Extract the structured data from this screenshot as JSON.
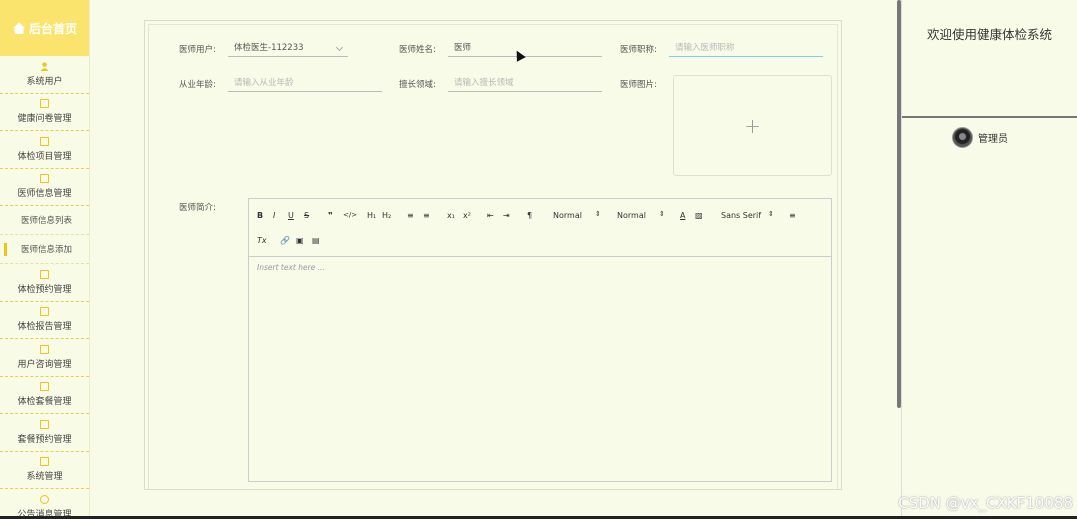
{
  "sidebar": {
    "title": "后台首页",
    "items": [
      {
        "label": "系统用户",
        "icon": "person-icon"
      },
      {
        "label": "健康问卷管理",
        "icon": "edit-icon"
      },
      {
        "label": "体检项目管理",
        "icon": "edit-icon"
      },
      {
        "label": "医师信息管理",
        "icon": "edit-icon"
      }
    ],
    "subitems": [
      {
        "label": "医师信息列表"
      },
      {
        "label": "医师信息添加"
      }
    ],
    "items2": [
      {
        "label": "体检预约管理",
        "icon": "edit-icon"
      },
      {
        "label": "体检报告管理",
        "icon": "edit-icon"
      },
      {
        "label": "用户咨询管理",
        "icon": "edit-icon"
      },
      {
        "label": "体检套餐管理",
        "icon": "edit-icon"
      },
      {
        "label": "套餐预约管理",
        "icon": "edit-icon"
      },
      {
        "label": "系统管理",
        "icon": "settings-icon"
      },
      {
        "label": "公告消息管理",
        "icon": "info-icon"
      }
    ]
  },
  "form": {
    "doctor_user_label": "医师用户:",
    "doctor_user_value": "体检医生-112233",
    "doctor_name_label": "医师姓名:",
    "doctor_name_value": "医师",
    "doctor_title_label": "医师职称:",
    "doctor_title_placeholder": "请输入医师职称",
    "years_label": "从业年龄:",
    "years_placeholder": "请输入从业年龄",
    "specialty_label": "擅长领域:",
    "specialty_placeholder": "请输入擅长领域",
    "photo_label": "医师图片:",
    "intro_label": "医师简介:",
    "editor_placeholder": "Insert text here ...",
    "toolbar": {
      "bold": "B",
      "italic": "I",
      "underline": "U",
      "strike": "S",
      "quote": "❞",
      "code": "</>",
      "h1": "H₁",
      "h2": "H₂",
      "ordered": "≡",
      "bullet": "≡",
      "sub": "x₁",
      "sup": "x²",
      "outdent": "⇤",
      "indent": "⇥",
      "direction": "¶",
      "size": "Normal",
      "header": "Normal",
      "font": "Sans Serif",
      "align": "≡",
      "clean": "Tx",
      "link": "🔗",
      "image": "▣",
      "video": "▤"
    }
  },
  "header": {
    "welcome": "欢迎使用健康体检系统",
    "user": "管理员"
  },
  "watermark": "CSDN @vx_CXKF10088"
}
